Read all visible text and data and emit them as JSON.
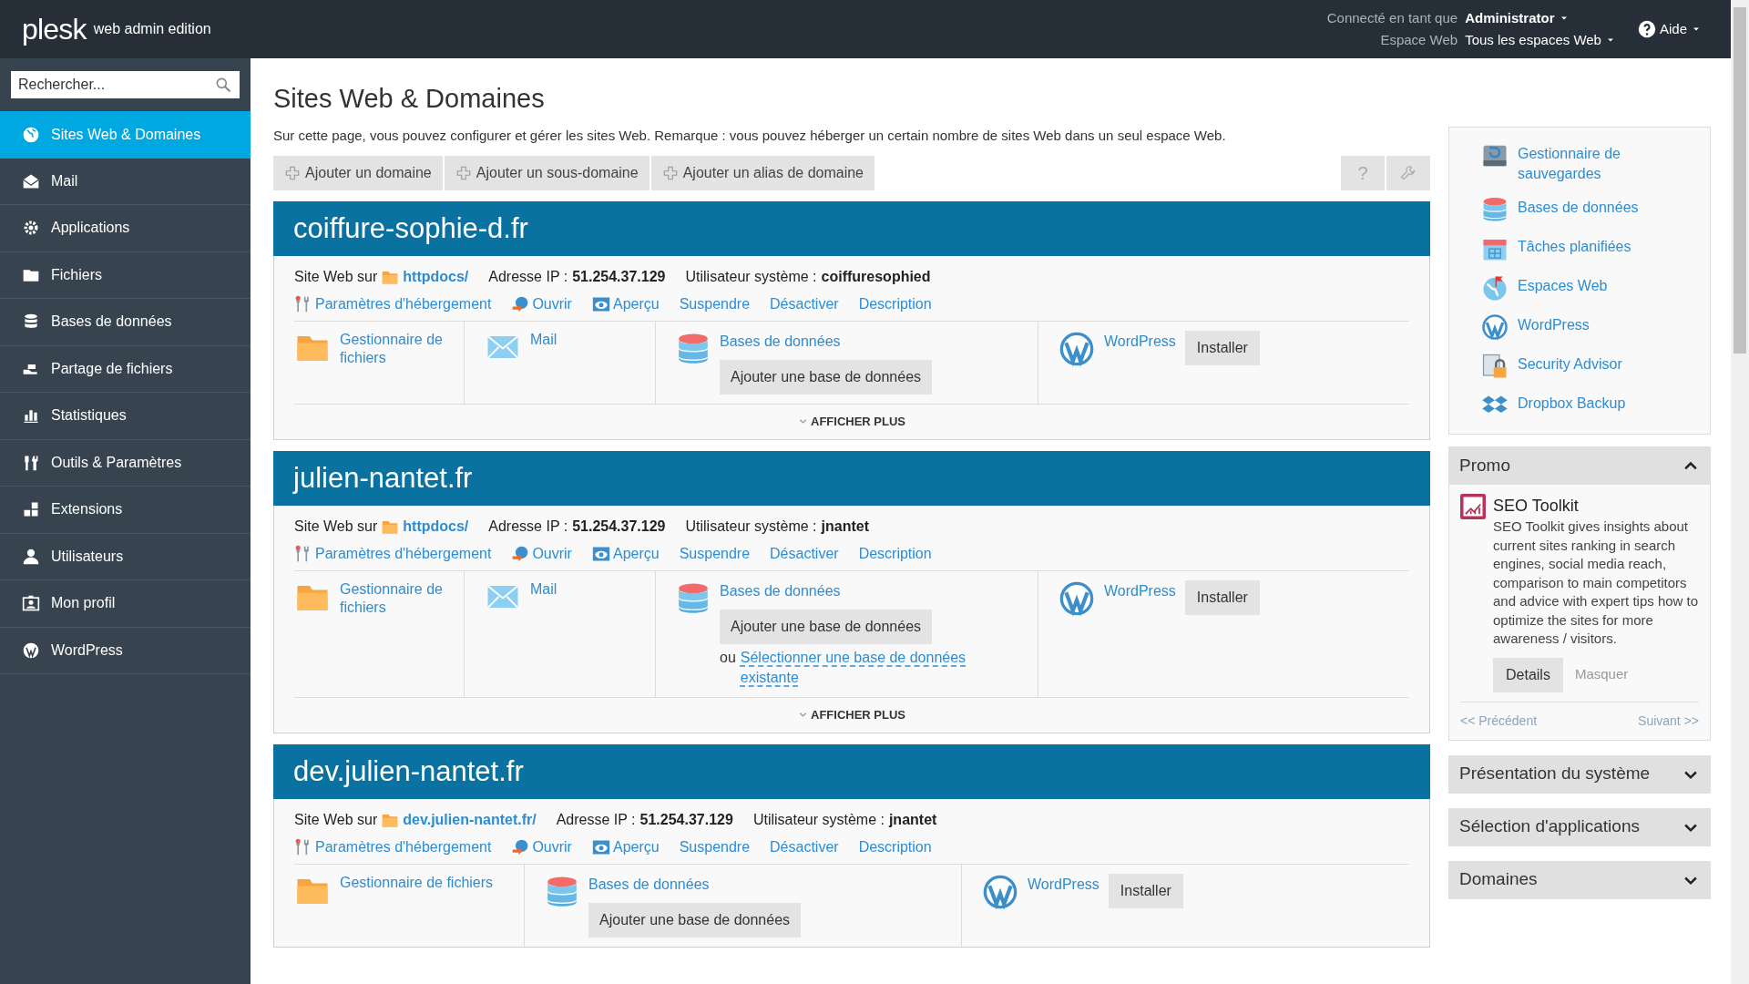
{
  "header": {
    "logo": "plesk",
    "edition": "web admin edition",
    "logged_in_label": "Connecté en tant que",
    "user": "Administrator",
    "space_label": "Espace Web",
    "space": "Tous les espaces Web",
    "help": "Aide"
  },
  "sidebar": {
    "search": {
      "placeholder": "Rechercher..."
    },
    "items": [
      {
        "label": "Sites Web & Domaines",
        "kind": "globe",
        "selected": true
      },
      {
        "label": "Mail",
        "kind": "mail",
        "selected": false
      },
      {
        "label": "Applications",
        "kind": "gear",
        "selected": false
      },
      {
        "label": "Fichiers",
        "kind": "folder",
        "selected": false
      },
      {
        "label": "Bases de données",
        "kind": "database",
        "selected": false
      },
      {
        "label": "Partage de fichiers",
        "kind": "share",
        "selected": false
      },
      {
        "label": "Statistiques",
        "kind": "chart",
        "selected": false
      },
      {
        "label": "Outils & Paramètres",
        "kind": "tools",
        "selected": false
      },
      {
        "label": "Extensions",
        "kind": "blocks",
        "selected": false
      },
      {
        "label": "Utilisateurs",
        "kind": "user",
        "selected": false
      },
      {
        "label": "Mon profil",
        "kind": "profile",
        "selected": false
      },
      {
        "label": "WordPress",
        "kind": "wordpress",
        "selected": false
      }
    ]
  },
  "main": {
    "title": "Sites Web & Domaines",
    "description": "Sur cette page, vous pouvez configurer et gérer les sites Web. Remarque : vous pouvez héberger un certain nombre de sites Web dans un seul espace Web.",
    "toolbar": [
      "Ajouter un domaine",
      "Ajouter un sous-domaine",
      "Ajouter un alias de domaine"
    ],
    "help_button": "?",
    "domains": [
      {
        "name": "coiffure-sophie-d.fr",
        "site_label": "Site Web sur",
        "path": "httpdocs/",
        "ip_label": "Adresse IP :",
        "ip": "51.254.37.129",
        "user_label": "Utilisateur système :",
        "user": "coiffuresophied",
        "actions": [
          {
            "kind": "hosting",
            "label": "Paramètres d'hébergement"
          },
          {
            "kind": "open",
            "label": "Ouvrir"
          },
          {
            "kind": "preview",
            "label": "Aperçu"
          },
          {
            "kind": "plain",
            "label": "Suspendre"
          },
          {
            "kind": "plain",
            "label": "Désactiver"
          },
          {
            "kind": "plain",
            "label": "Description"
          }
        ],
        "tools": [
          {
            "kind": "files",
            "label": "Gestionnaire de fichiers"
          },
          {
            "kind": "mail",
            "label": "Mail"
          },
          {
            "kind": "databases",
            "label": "Bases de données",
            "button": "Ajouter une base de données"
          },
          {
            "kind": "wordpress",
            "label": "WordPress",
            "button": "Installer"
          }
        ],
        "show_more": "AFFICHER PLUS"
      },
      {
        "name": "julien-nantet.fr",
        "site_label": "Site Web sur",
        "path": "httpdocs/",
        "ip_label": "Adresse IP :",
        "ip": "51.254.37.129",
        "user_label": "Utilisateur système :",
        "user": "jnantet",
        "actions": [
          {
            "kind": "hosting",
            "label": "Paramètres d'hébergement"
          },
          {
            "kind": "open",
            "label": "Ouvrir"
          },
          {
            "kind": "preview",
            "label": "Aperçu"
          },
          {
            "kind": "plain",
            "label": "Suspendre"
          },
          {
            "kind": "plain",
            "label": "Désactiver"
          },
          {
            "kind": "plain",
            "label": "Description"
          }
        ],
        "tools": [
          {
            "kind": "files",
            "label": "Gestionnaire de fichiers"
          },
          {
            "kind": "mail",
            "label": "Mail"
          },
          {
            "kind": "databases",
            "label": "Bases de données",
            "button": "Ajouter une base de données",
            "or": "ou",
            "select_link": "Sélectionner une base de données existante"
          },
          {
            "kind": "wordpress",
            "label": "WordPress",
            "button": "Installer"
          }
        ],
        "show_more": "AFFICHER PLUS"
      },
      {
        "name": "dev.julien-nantet.fr",
        "site_label": "Site Web sur",
        "path": "dev.julien-nantet.fr/",
        "ip_label": "Adresse IP :",
        "ip": "51.254.37.129",
        "user_label": "Utilisateur système :",
        "user": "jnantet",
        "actions": [
          {
            "kind": "hosting",
            "label": "Paramètres d'hébergement"
          },
          {
            "kind": "open",
            "label": "Ouvrir"
          },
          {
            "kind": "preview",
            "label": "Aperçu"
          },
          {
            "kind": "plain",
            "label": "Suspendre"
          },
          {
            "kind": "plain",
            "label": "Désactiver"
          },
          {
            "kind": "plain",
            "label": "Description"
          }
        ],
        "tools": [
          {
            "kind": "files",
            "label": "Gestionnaire de fichiers"
          },
          {
            "kind": "databases",
            "label": "Bases de données",
            "button": "Ajouter une base de données"
          },
          {
            "kind": "wordpress",
            "label": "WordPress",
            "button": "Installer"
          }
        ]
      }
    ]
  },
  "right_panel": {
    "links": [
      {
        "kind": "backup",
        "label": "Gestionnaire de sauvegardes"
      },
      {
        "kind": "database",
        "label": "Bases de données"
      },
      {
        "kind": "calendar",
        "label": "Tâches planifiées"
      },
      {
        "kind": "globe",
        "label": "Espaces Web"
      },
      {
        "kind": "wordpress",
        "label": "WordPress"
      },
      {
        "kind": "lock",
        "label": "Security Advisor"
      },
      {
        "kind": "dropbox",
        "label": "Dropbox Backup"
      }
    ],
    "promo": {
      "title": "Promo",
      "expanded": true,
      "item_title": "SEO Toolkit",
      "text": "SEO Toolkit gives insights about current sites ranking in search engines, social media reach, comparison to main competitors and advice with expert tips how to optimize the sites for more awareness / visitors.",
      "details": "Details",
      "hide": "Masquer",
      "previous": "<< Précédent",
      "next": "Suivant >>"
    },
    "panels": [
      {
        "title": "Présentation du système",
        "expanded": false
      },
      {
        "title": "Sélection d'applications",
        "expanded": false
      },
      {
        "title": "Domaines",
        "expanded": false
      }
    ]
  }
}
